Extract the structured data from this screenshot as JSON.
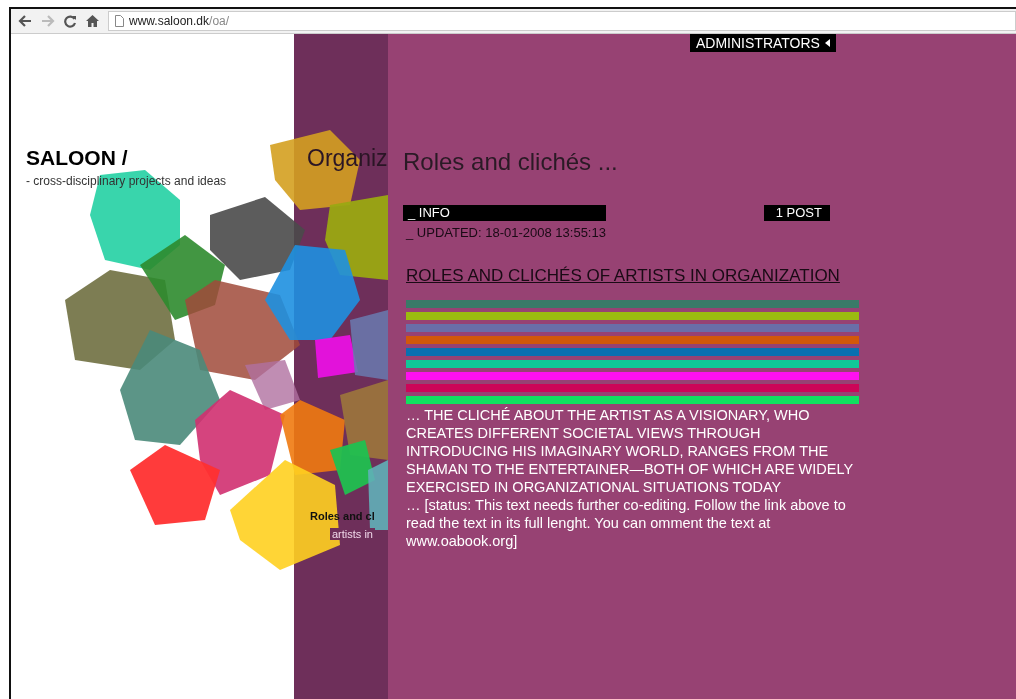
{
  "browser": {
    "url_host": "www.saloon.dk",
    "url_path": "/oa/"
  },
  "site": {
    "title": "SALOON /",
    "tagline": "-  cross-disciplinary projects and ideas"
  },
  "background_texts": {
    "heading": "Organiz",
    "post_title": "Roles and cl",
    "post_subtitle": "artists in"
  },
  "admin_tab": {
    "label": "ADMINISTRATORS",
    "expanded": false
  },
  "post": {
    "title": "Roles and clichés ...",
    "info_label": "_ INFO",
    "post_count": "1 POST",
    "updated": "_ UPDATED: 18-01-2008 13:55:13",
    "link": "ROLES AND CLICHÉS OF ARTISTS IN ORGANIZATION",
    "stripes": [
      {
        "color": "#3a7a68"
      },
      {
        "color": "#9bbb10"
      },
      {
        "color": "#6a6ea8"
      },
      {
        "color": "#d2580a"
      },
      {
        "color": "#0a70b0"
      },
      {
        "color": "#10c898"
      },
      {
        "color": "#ff10f0"
      },
      {
        "color": "#cc0658"
      },
      {
        "color": "#10e060"
      }
    ],
    "body": "… THE CLICHÉ ABOUT THE ARTIST AS A VISIONARY, WHO CREATES DIFFERENT SOCIETAL VIEWS THROUGH INTRODUCING HIS IMAGINARY WORLD, RANGES FROM THE SHAMAN TO THE ENTERTAINER—BOTH OF WHICH ARE WIDELY EXERCISED IN ORGANIZATIONAL SITUATIONS TODAY",
    "status": "… [status: This text needs further co-editing. Follow the link above to read the text in its full lenght. You can omment the text at www.oabook.org]"
  }
}
